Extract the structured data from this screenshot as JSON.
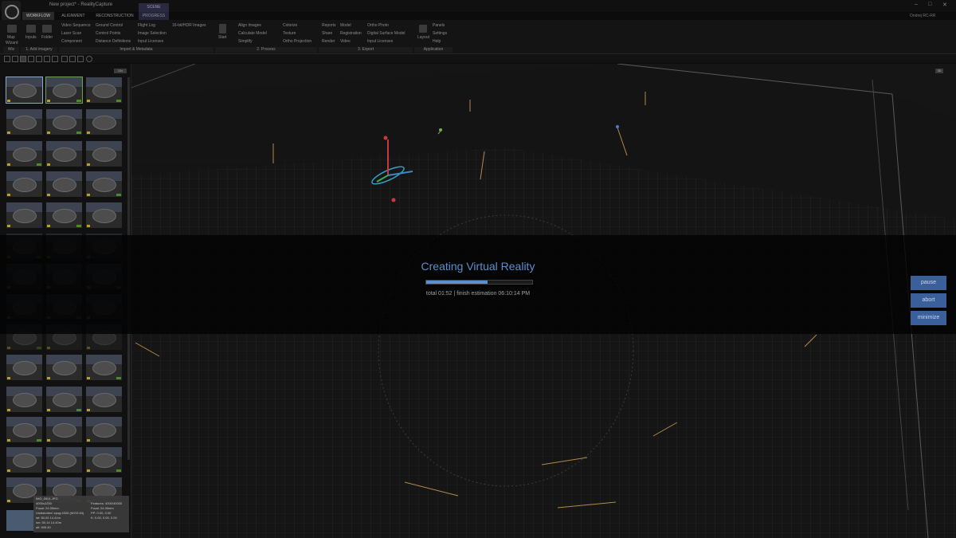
{
  "window": {
    "title": "New project* - RealityCapture",
    "user": "Ondrej RC-RR",
    "scene_tab": "SCENE",
    "controls": [
      "–",
      "□",
      "✕"
    ]
  },
  "tabs": [
    "WORKFLOW",
    "ALIGNMENT",
    "RECONSTRUCTION",
    "PROGRESS"
  ],
  "ribbon": {
    "col1": [
      "Map",
      "Wizard"
    ],
    "inputs": "Inputs",
    "folder": "Folder",
    "import": [
      "Video Sequence",
      "Laser Scan",
      "Component"
    ],
    "import2": [
      "Ground Control",
      "Control Points",
      "Distance Definitions"
    ],
    "import3": [
      "Flight Log",
      "Image Selection",
      "Input Licenses"
    ],
    "hdr": "16-bit/HDR Images",
    "start": "Start",
    "process": [
      "Align Images",
      "Calculate Model",
      "Simplify"
    ],
    "process2": [
      "Colorize",
      "Texture",
      "Ortho Projection"
    ],
    "export": [
      "Reports",
      "Share",
      "Render"
    ],
    "export2": [
      "Model",
      "Registration",
      "Video"
    ],
    "export3": [
      "Ortho Photo",
      "Digital Surface Model",
      "Input Licenses"
    ],
    "layout": "Layout",
    "app": [
      "Panels",
      "Settings",
      "Help"
    ],
    "groups": [
      "Wiz",
      "1. Add imagery",
      "Import & Metadata",
      "2. Process",
      "3. Export",
      "Application"
    ]
  },
  "left_panel": {
    "count": "10x",
    "info": {
      "line1": "IMG_0001.JPG",
      "line2": "4000x2250",
      "line3": "Focal: 24.00mm",
      "line4": "Undistorted: epsg:4326 (WGS 84)",
      "line5": "lat: 50.09 14.41m",
      "line6": "lon: 50.14 14.40m",
      "line7": "alt: 405.40",
      "right1": "Features: 4000/40000",
      "right2": "Focal: 24.00mm",
      "right3": "PP: 0.00, 0.00",
      "right4": "K: 0.00, 0.00, 0.00"
    }
  },
  "viewport": {
    "mode_label": "3D"
  },
  "progress": {
    "title": "Creating Virtual Reality",
    "fraction": 0.58,
    "status": "total 01:52 | finish estimation 06:10:14 PM",
    "buttons": [
      "pause",
      "abort",
      "minimize"
    ]
  }
}
